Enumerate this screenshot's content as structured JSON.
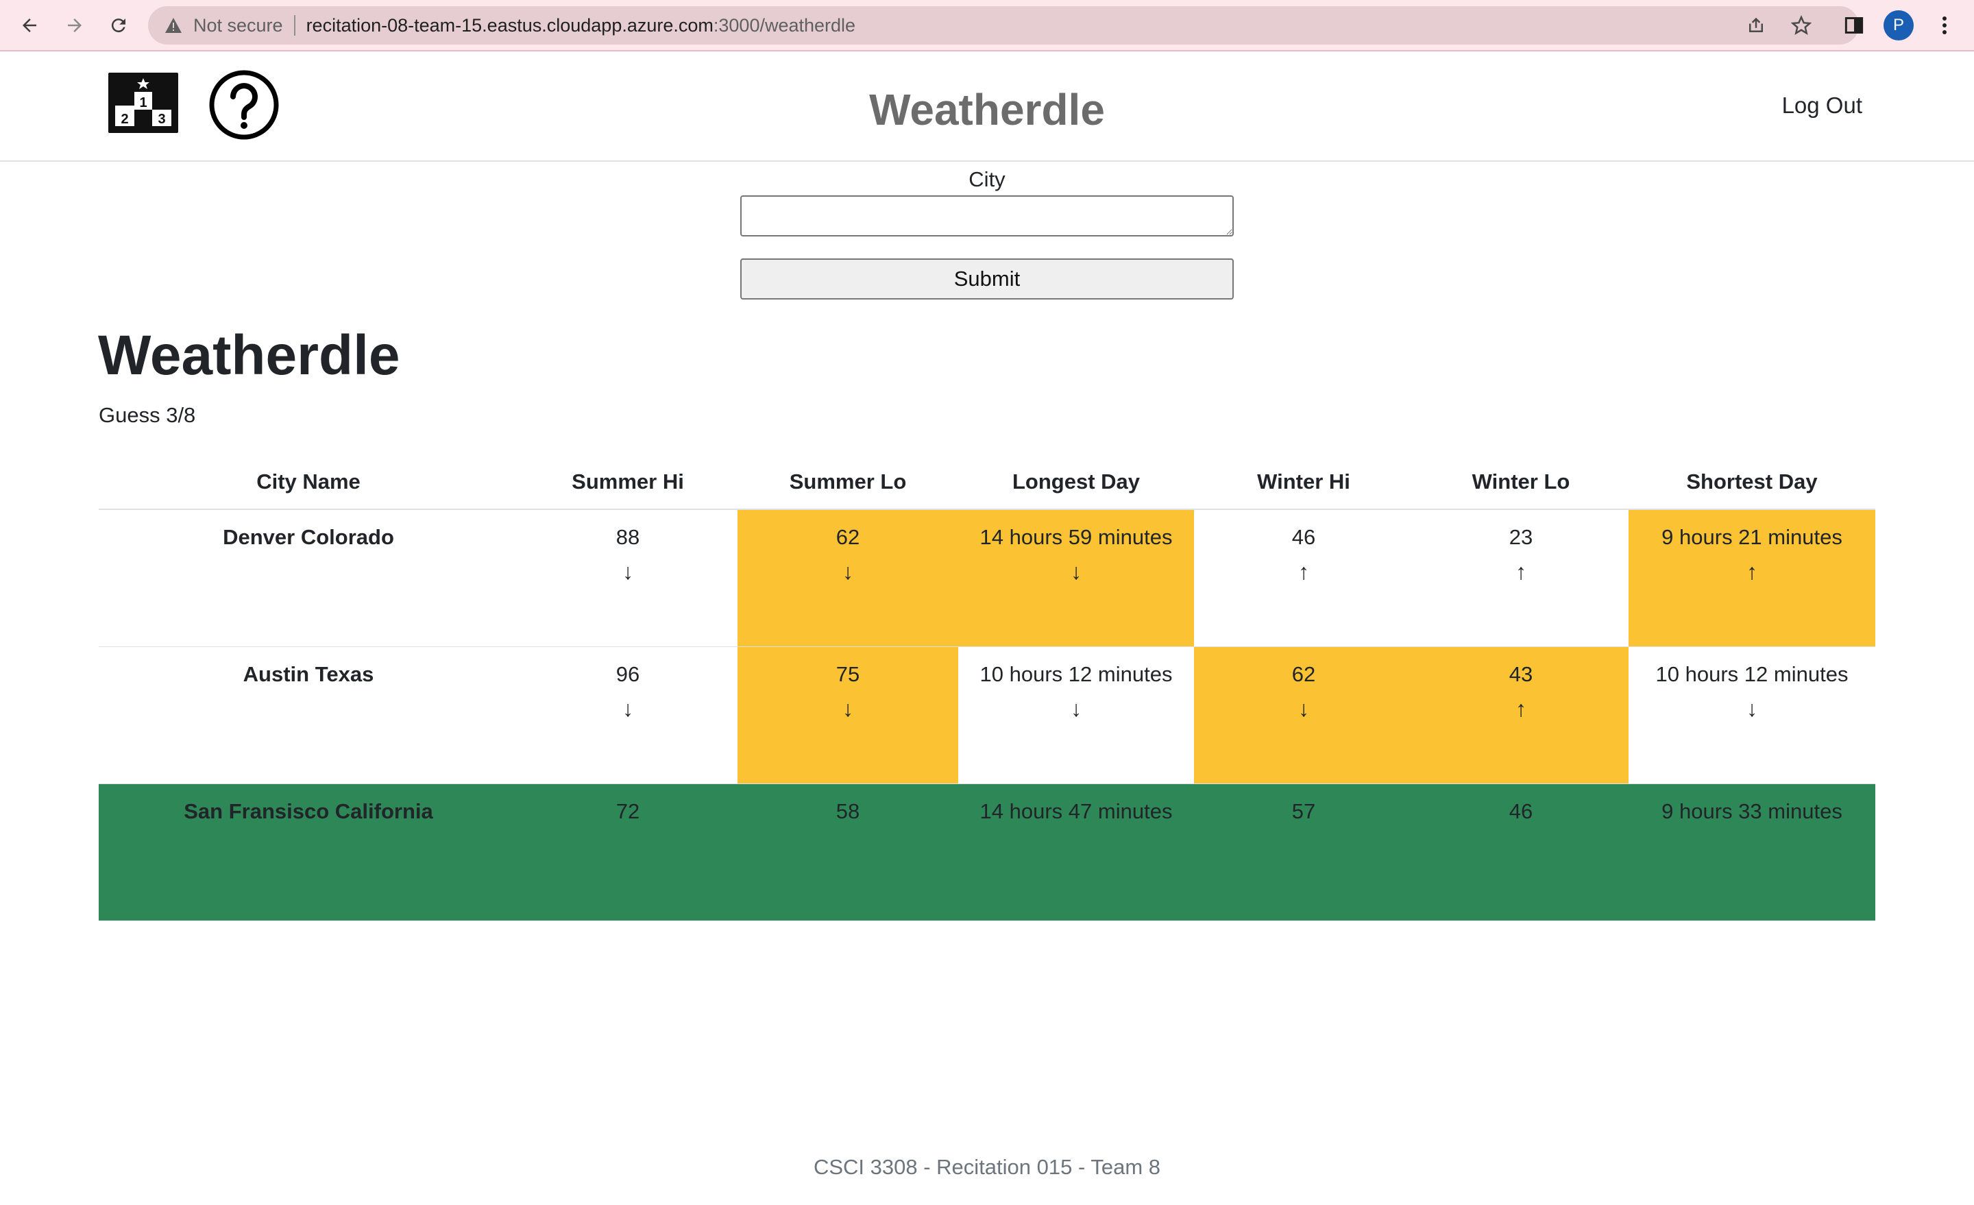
{
  "browser": {
    "security_label": "Not secure",
    "url_host": "recitation-08-team-15.eastus.cloudapp.azure.com",
    "url_rest": ":3000/weatherdle",
    "profile_initial": "P"
  },
  "header": {
    "title": "Weatherdle",
    "logout_label": "Log Out"
  },
  "form": {
    "city_label": "City",
    "city_value": "",
    "submit_label": "Submit"
  },
  "game": {
    "title": "Weatherdle",
    "guess_status": "Guess 3/8"
  },
  "table": {
    "headers": [
      "City Name",
      "Summer Hi",
      "Summer Lo",
      "Longest Day",
      "Winter Hi",
      "Winter Lo",
      "Shortest Day"
    ],
    "rows": [
      {
        "city": "Denver Colorado",
        "summer_hi": "88",
        "summer_hi_hint": "↓",
        "summer_lo": "62",
        "summer_lo_hint": "↓",
        "longest_day": "14 hours 59 minutes",
        "longest_day_hint": "↓",
        "winter_hi": "46",
        "winter_hi_hint": "↑",
        "winter_lo": "23",
        "winter_lo_hint": "↑",
        "shortest_day": "9 hours 21 minutes",
        "shortest_day_hint": "↑"
      },
      {
        "city": "Austin Texas",
        "summer_hi": "96",
        "summer_hi_hint": "↓",
        "summer_lo": "75",
        "summer_lo_hint": "↓",
        "longest_day": "10 hours 12 minutes",
        "longest_day_hint": "↓",
        "winter_hi": "62",
        "winter_hi_hint": "↓",
        "winter_lo": "43",
        "winter_lo_hint": "↑",
        "shortest_day": "10 hours 12 minutes",
        "shortest_day_hint": "↓"
      },
      {
        "city": "San Fransisco California",
        "summer_hi": "72",
        "summer_lo": "58",
        "longest_day": "14 hours 47 minutes",
        "winter_hi": "57",
        "winter_lo": "46",
        "shortest_day": "9 hours 33 minutes"
      }
    ]
  },
  "colors": {
    "close_guess": "#fbc233",
    "correct_guess": "#2e8757"
  },
  "footer": {
    "text": "CSCI 3308 - Recitation 015 - Team 8"
  }
}
